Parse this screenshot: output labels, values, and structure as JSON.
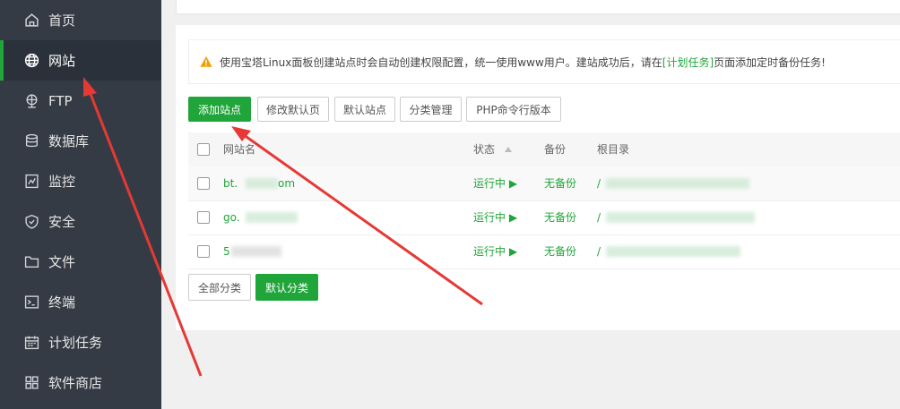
{
  "sidebar": {
    "items": [
      {
        "label": "首页",
        "icon": "home-icon"
      },
      {
        "label": "网站",
        "icon": "globe-icon",
        "active": true
      },
      {
        "label": "FTP",
        "icon": "ftp-icon"
      },
      {
        "label": "数据库",
        "icon": "database-icon"
      },
      {
        "label": "监控",
        "icon": "monitor-icon"
      },
      {
        "label": "安全",
        "icon": "shield-icon"
      },
      {
        "label": "文件",
        "icon": "folder-icon"
      },
      {
        "label": "终端",
        "icon": "terminal-icon"
      },
      {
        "label": "计划任务",
        "icon": "calendar-icon"
      },
      {
        "label": "软件商店",
        "icon": "apps-icon"
      }
    ]
  },
  "notice": {
    "text_before": "使用宝塔Linux面板创建站点时会自动创建权限配置，统一使用www用户。建站成功后，请在",
    "link": "[计划任务]",
    "text_after": "页面添加定时备份任务!"
  },
  "toolbar": {
    "add_site": "添加站点",
    "edit_default_page": "修改默认页",
    "default_site": "默认站点",
    "category_manage": "分类管理",
    "php_version": "PHP命令行版本"
  },
  "table": {
    "headers": {
      "name": "网站名",
      "status": "状态",
      "backup": "备份",
      "root": "根目录"
    },
    "rows": [
      {
        "name": "bt.",
        "name_tail": "om",
        "status": "运行中",
        "backup": "无备份",
        "root": "/",
        "root_tail": "..."
      },
      {
        "name": "go.",
        "name_tail": "",
        "status": "运行中",
        "backup": "无备份",
        "root": "/",
        "root_tail": ""
      },
      {
        "name": "5",
        "name_tail": "",
        "status": "运行中",
        "backup": "无备份",
        "root": "/",
        "root_tail": ""
      }
    ]
  },
  "categories": {
    "all": "全部分类",
    "default": "默认分类"
  },
  "colors": {
    "brand_green": "#20a53a",
    "sidebar_bg": "#353b45",
    "arrow_red": "#e53935"
  }
}
